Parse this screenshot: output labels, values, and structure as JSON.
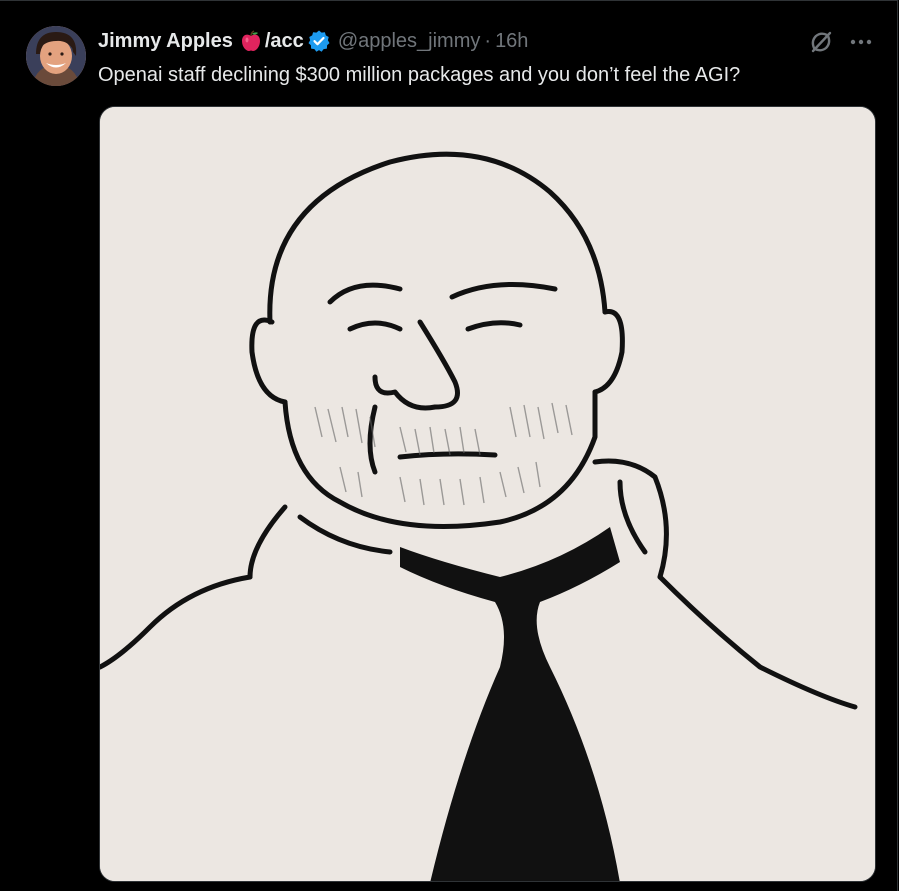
{
  "tweet": {
    "display_name": "Jimmy Apples",
    "name_suffix": "/acc",
    "handle": "@apples_jimmy",
    "separator": "·",
    "timestamp": "16h",
    "text": "Openai staff declining $300 million packages and you don’t feel the AGI?"
  },
  "icons": {
    "apple": "red-apple-emoji",
    "verified": "verified-badge",
    "grok": "grok-icon",
    "more": "more-options-icon"
  },
  "colors": {
    "background": "#000000",
    "text_primary": "#e7e9ea",
    "text_secondary": "#71767b",
    "verified_blue": "#1d9bf0",
    "border": "#2f3336",
    "drawing_paper": "#ece7e2"
  }
}
